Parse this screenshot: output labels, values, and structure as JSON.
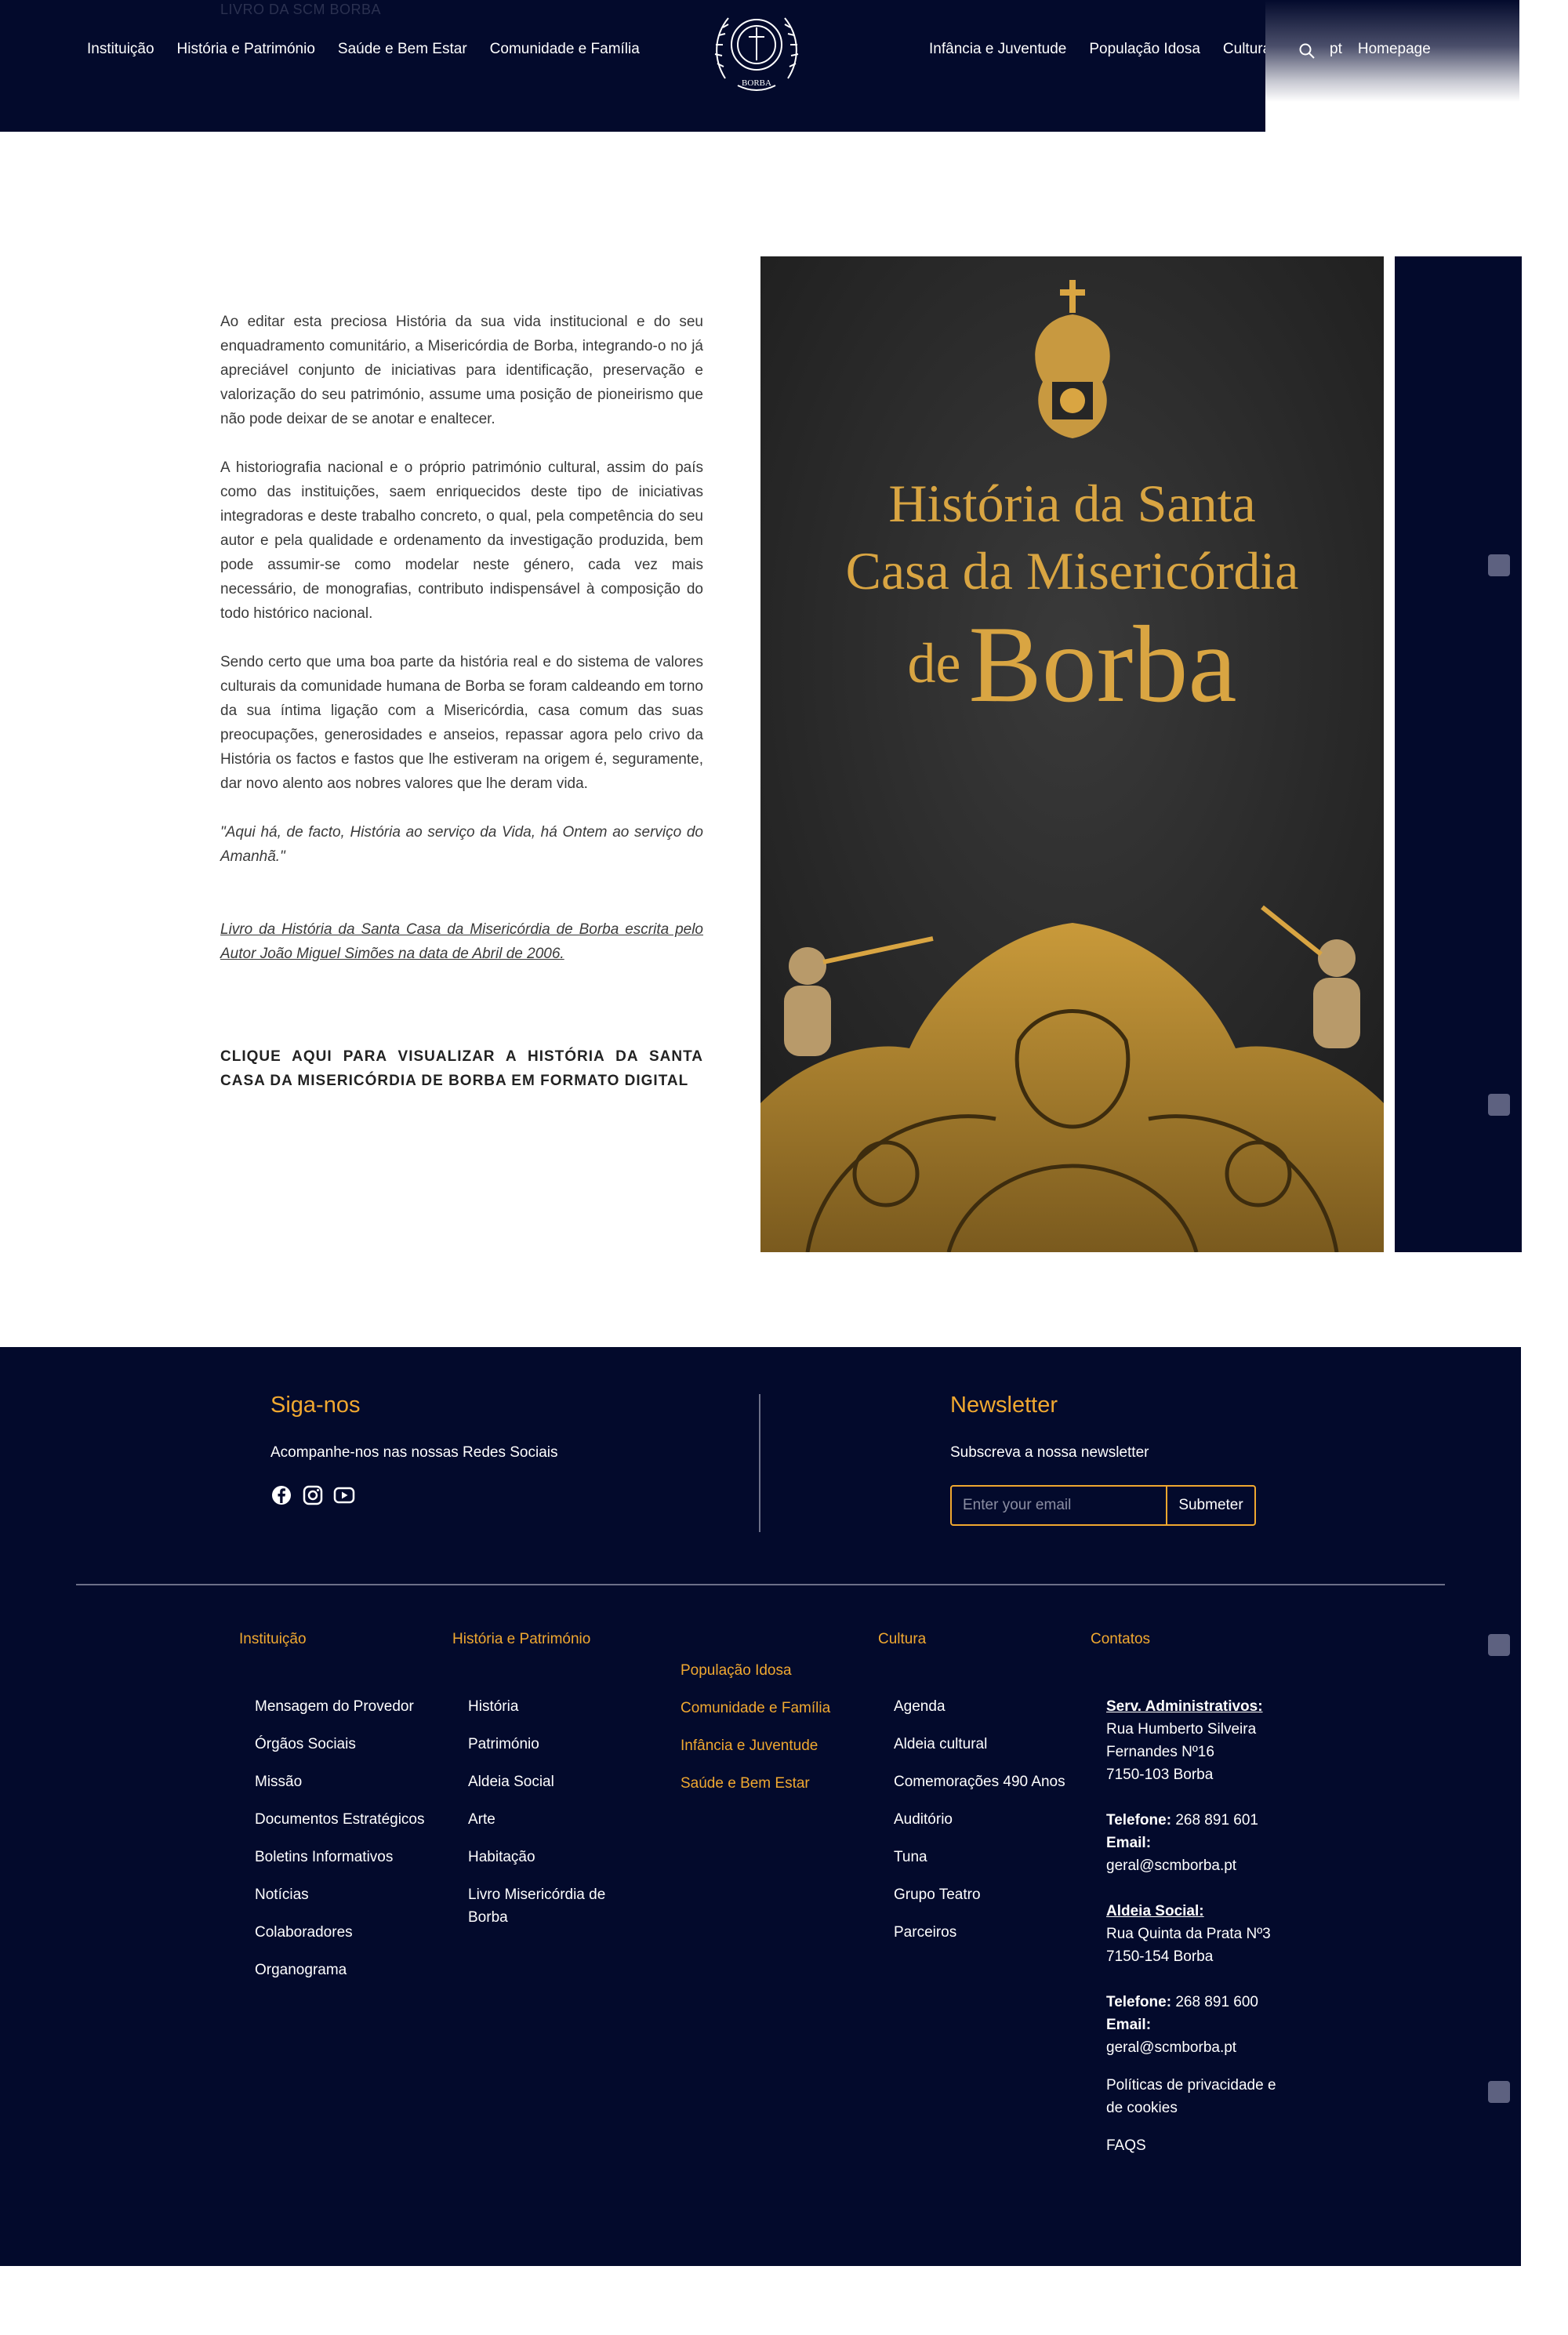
{
  "header": {
    "breadcrumb": "LIVRO DA SCM BORBA",
    "nav_left": [
      "Instituição",
      "História e Património",
      "Saúde e Bem Estar",
      "Comunidade e Família"
    ],
    "nav_right": [
      "Infância e Juventude",
      "População Idosa",
      "Cultura"
    ],
    "language": "pt",
    "homepage": "Homepage",
    "logo_text": "BORBA"
  },
  "content": {
    "paragraphs": [
      "Ao editar esta preciosa História da sua vida institucional e do seu enquadramento comunitário, a Misericórdia de Borba, integrando-o no já apreciável conjunto de iniciativas para identificação, preservação e valorização do seu património, assume uma posição de pioneirismo que não pode deixar de se anotar e enaltecer.",
      "A historiografia nacional e o próprio património cultural, assim do país como das instituições, saem enriquecidos deste tipo de iniciativas integradoras e deste trabalho concreto, o qual, pela competência do seu autor e pela qualidade e ordenamento da investigação produzida, bem pode assumir-se como modelar neste género, cada vez mais necessário, de monografias, contributo indispensável à composição do todo histórico nacional.",
      "Sendo certo que uma boa parte da história real e do sistema de valores culturais da comunidade humana de Borba se foram caldeando em torno da sua íntima ligação com a Misericórdia, casa comum das suas preocupações, generosidades e anseios, repassar agora pelo crivo da História os factos e fastos que lhe estiveram na origem é, seguramente, dar novo alento aos nobres valores que lhe deram vida."
    ],
    "quote": "\"Aqui há, de facto, História ao serviço da Vida, há Ontem ao serviço do Amanhã.\"",
    "caption": "Livro da História da Santa Casa da Misericórdia de Borba escrita pelo Autor João Miguel Simões na data de Abril de 2006.",
    "cta": "CLIQUE AQUI PARA VISUALIZAR A HISTÓRIA DA SANTA CASA DA MISERICÓRDIA DE BORBA EM FORMATO DIGITAL",
    "book": {
      "line1": "História da Santa",
      "line2": "Casa da Misericórdia",
      "line3_small": "de",
      "line3_big": "Borba"
    }
  },
  "footer": {
    "follow_title": "Siga-nos",
    "follow_text": "Acompanhe-nos nas nossas Redes Sociais",
    "newsletter_title": "Newsletter",
    "newsletter_text": "Subscreva a nossa newsletter",
    "email_placeholder": "Enter your email",
    "submit_label": "Submeter",
    "col_instituicao": {
      "heading": "Instituição",
      "items": [
        "Mensagem do Provedor",
        "Órgãos Sociais",
        "Missão",
        "Documentos Estratégicos",
        "Boletins Informativos",
        "Notícias",
        "Colaboradores",
        "Organograma"
      ]
    },
    "col_historia": {
      "heading": "História e Património",
      "items": [
        "História",
        "Património",
        "Aldeia Social",
        "Arte",
        "Habitação",
        "Livro Misericórdia de Borba"
      ]
    },
    "col_middle": {
      "items": [
        "População Idosa",
        "Comunidade e Família",
        "Infância e Juventude",
        "Saúde e Bem Estar"
      ]
    },
    "col_cultura": {
      "heading": "Cultura",
      "items": [
        "Agenda",
        "Aldeia cultural",
        "Comemorações 490 Anos",
        "Auditório",
        "Tuna",
        "Grupo Teatro",
        "Parceiros"
      ]
    },
    "contacts": {
      "heading": "Contatos",
      "admin_title": "Serv. Administrativos:",
      "admin_address": "Rua Humberto Silveira Fernandes Nº16",
      "admin_postal": "7150-103 Borba",
      "phone_label": "Telefone:",
      "admin_phone": "268 891 601",
      "email_label": "Email:",
      "admin_email": "geral@scmborba.pt",
      "aldeia_title": "Aldeia Social:",
      "aldeia_address": "Rua Quinta da Prata Nº3",
      "aldeia_postal": "7150-154 Borba",
      "aldeia_phone": "268 891 600",
      "aldeia_email": "geral@scmborba.pt",
      "privacy": "Políticas de privacidade e de cookies",
      "faqs": "FAQS"
    }
  },
  "colors": {
    "navy": "#030a2c",
    "accent": "#f0a830",
    "gold": "#d9a542"
  }
}
